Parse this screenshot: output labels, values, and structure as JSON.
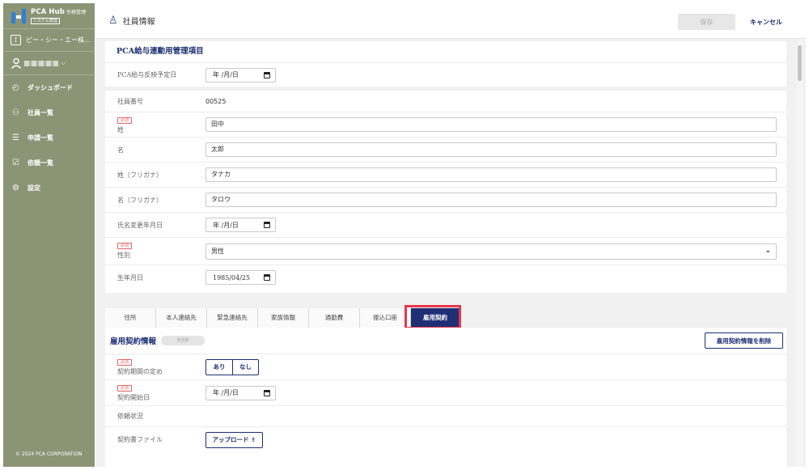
{
  "sidebar": {
    "logo_title": "PCA Hub",
    "logo_sub": "労務管理",
    "logo_badge": "システム管理",
    "company": "ピー・シー・エー株...",
    "nav": [
      {
        "label": "ダッシュボード",
        "icon": "dashboard-icon"
      },
      {
        "label": "社員一覧",
        "icon": "people-icon"
      },
      {
        "label": "申請一覧",
        "icon": "list-icon"
      },
      {
        "label": "依頼一覧",
        "icon": "checkbox-icon"
      },
      {
        "label": "設定",
        "icon": "gear-icon"
      }
    ],
    "copyright": "© 2024 PCA CORPORATION"
  },
  "header": {
    "title": "社員情報",
    "save_label": "保存",
    "cancel_label": "キャンセル"
  },
  "pca_section": {
    "title": "PCA給与連動用管理項目",
    "rows": [
      {
        "label": "PCA給与反映予定日",
        "value": "年 /月/日"
      }
    ]
  },
  "basic": {
    "employee_no_label": "社員番号",
    "employee_no": "00525",
    "required_badge": "必須",
    "last_name_label": "姓",
    "last_name": "田中",
    "first_name_label": "名",
    "first_name": "太郎",
    "last_kana_label": "姓（フリガナ）",
    "last_kana": "タナカ",
    "first_kana_label": "名（フリガナ）",
    "first_kana": "タロウ",
    "name_change_label": "氏名変更年月日",
    "name_change": "年 /月/日",
    "gender_label": "性別",
    "gender": "男性",
    "birth_label": "生年月日",
    "birth": "1985/04/25"
  },
  "tabs": [
    "住所",
    "本人連絡先",
    "緊急連絡先",
    "家族情報",
    "通勤費",
    "振込口座",
    "雇用契約"
  ],
  "contract": {
    "title": "雇用契約情報",
    "status_pill": "未登録",
    "delete_label": "雇用契約情報を削除",
    "term_label": "契約期間の定め",
    "term_yes": "あり",
    "term_no": "なし",
    "start_label": "契約開始日",
    "start_value": "年 /月/日",
    "request_label": "依頼状況",
    "file_label": "契約書ファイル",
    "upload_label": "アップロード"
  }
}
